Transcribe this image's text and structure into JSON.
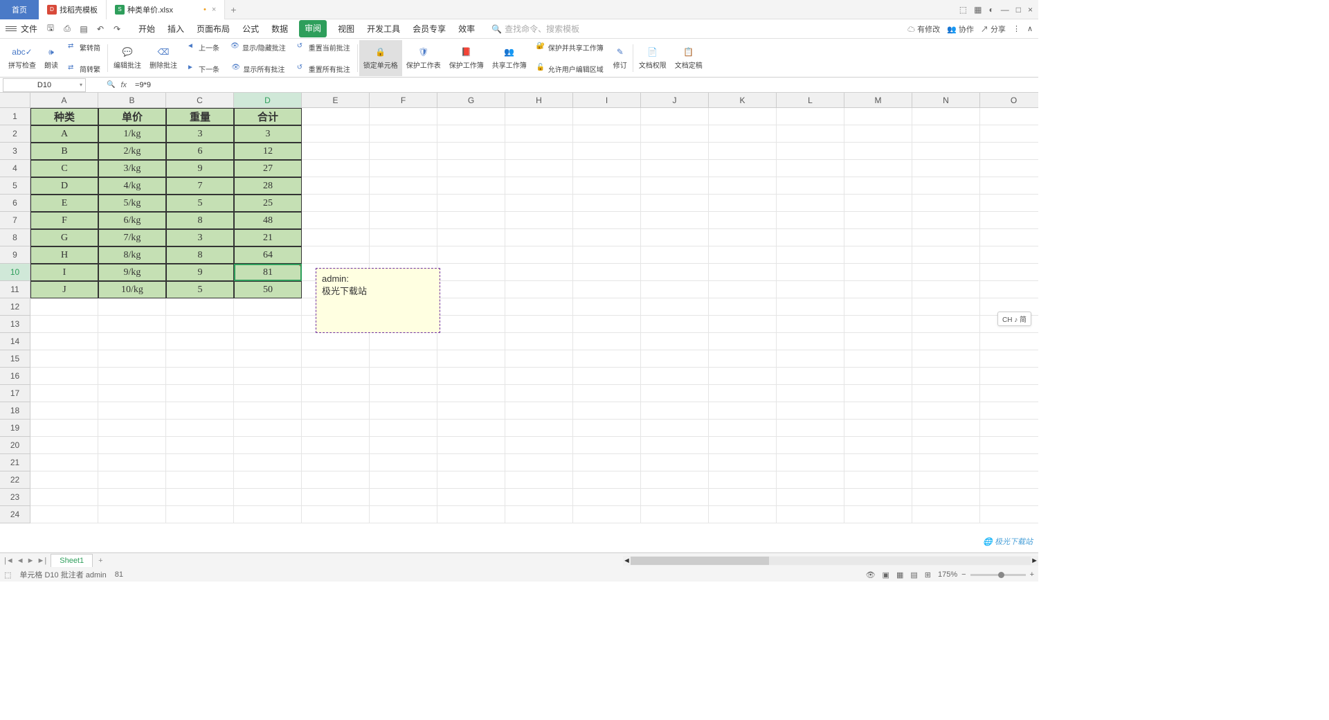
{
  "titlebar": {
    "home": "首页",
    "tabs": [
      {
        "icon": "D",
        "label": "找稻壳模板"
      },
      {
        "icon": "S",
        "label": "种类单价.xlsx",
        "modified": "•"
      }
    ]
  },
  "menubar": {
    "file": "文件",
    "tabs": [
      "开始",
      "插入",
      "页面布局",
      "公式",
      "数据",
      "审阅",
      "视图",
      "开发工具",
      "会员专享",
      "效率"
    ],
    "active_index": 5,
    "search_placeholder": "查找命令、搜索模板",
    "right": {
      "changes": "有修改",
      "collab": "协作",
      "share": "分享"
    }
  },
  "ribbon": {
    "spellcheck": "拼写检查",
    "read": "朗读",
    "trad": "繁转简",
    "simp": "简转繁",
    "edit_comment": "编辑批注",
    "del_comment": "删除批注",
    "prev": "上一条",
    "next": "下一条",
    "show_hide": "显示/隐藏批注",
    "show_all": "显示所有批注",
    "reset_cur": "重置当前批注",
    "reset_all": "重置所有批注",
    "lock": "锁定单元格",
    "protect_ws": "保护工作表",
    "protect_wb": "保护工作簿",
    "share_wb": "共享工作簿",
    "protect_share": "保护并共享工作簿",
    "allow_edit": "允许用户编辑区域",
    "track": "修订",
    "doc_perm": "文档权限",
    "doc_cert": "文档定稿"
  },
  "formulabar": {
    "cellref": "D10",
    "formula": "=9*9"
  },
  "grid": {
    "cols": [
      "A",
      "B",
      "C",
      "D",
      "E",
      "F",
      "G",
      "H",
      "I",
      "J",
      "K",
      "L",
      "M",
      "N",
      "O"
    ],
    "table": {
      "headers": [
        "种类",
        "单价",
        "重量",
        "合计"
      ],
      "rows": [
        [
          "A",
          "1/kg",
          "3",
          "3"
        ],
        [
          "B",
          "2/kg",
          "6",
          "12"
        ],
        [
          "C",
          "3/kg",
          "9",
          "27"
        ],
        [
          "D",
          "4/kg",
          "7",
          "28"
        ],
        [
          "E",
          "5/kg",
          "5",
          "25"
        ],
        [
          "F",
          "6/kg",
          "8",
          "48"
        ],
        [
          "G",
          "7/kg",
          "3",
          "21"
        ],
        [
          "H",
          "8/kg",
          "8",
          "64"
        ],
        [
          "I",
          "9/kg",
          "9",
          "81"
        ],
        [
          "J",
          "10/kg",
          "5",
          "50"
        ]
      ]
    },
    "comment": {
      "author": "admin:",
      "text": "极光下载站"
    }
  },
  "sheettabs": {
    "sheet": "Sheet1"
  },
  "statusbar": {
    "cell_info": "单元格 D10 批注者 admin",
    "value": "81",
    "zoom": "175%"
  },
  "lang_badge": "CH ♪ 简",
  "watermark": "极光下载站"
}
